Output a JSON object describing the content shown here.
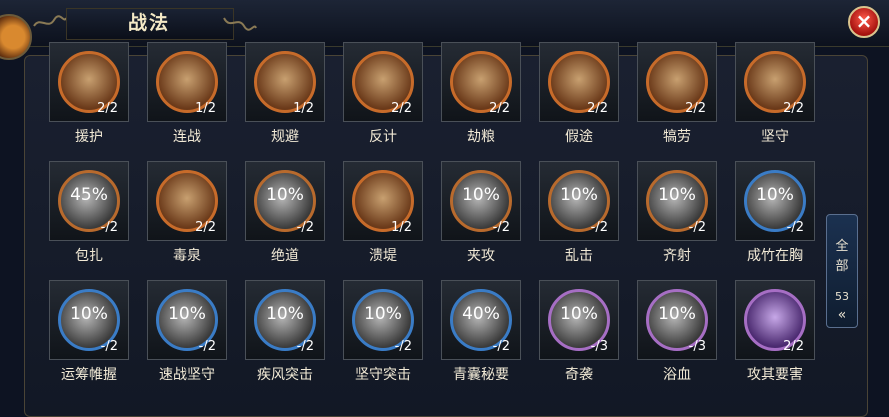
{
  "window": {
    "title": "战法",
    "close_label": "×"
  },
  "side_tab": {
    "line1": "全",
    "line2": "部",
    "count": "53",
    "arrow": "«"
  },
  "rows": [
    [
      {
        "name": "援护",
        "count": "2/2",
        "style": "orange"
      },
      {
        "name": "连战",
        "count": "1/2",
        "style": "orange"
      },
      {
        "name": "规避",
        "count": "1/2",
        "style": "orange"
      },
      {
        "name": "反计",
        "count": "2/2",
        "style": "orange"
      },
      {
        "name": "劫粮",
        "count": "2/2",
        "style": "orange"
      },
      {
        "name": "假途",
        "count": "2/2",
        "style": "orange"
      },
      {
        "name": "犒劳",
        "count": "2/2",
        "style": "orange"
      },
      {
        "name": "坚守",
        "count": "2/2",
        "style": "orange"
      }
    ],
    [
      {
        "name": "包扎",
        "pct": "45%",
        "count": "-/2",
        "style": "grey-o"
      },
      {
        "name": "毒泉",
        "count": "2/2",
        "style": "orange"
      },
      {
        "name": "绝道",
        "pct": "10%",
        "count": "-/2",
        "style": "grey-o"
      },
      {
        "name": "溃堤",
        "count": "1/2",
        "style": "orange"
      },
      {
        "name": "夹攻",
        "pct": "10%",
        "count": "-/2",
        "style": "grey-o"
      },
      {
        "name": "乱击",
        "pct": "10%",
        "count": "-/2",
        "style": "grey-o"
      },
      {
        "name": "齐射",
        "pct": "10%",
        "count": "-/2",
        "style": "grey-o"
      },
      {
        "name": "成竹在胸",
        "pct": "10%",
        "count": "-/2",
        "style": "grey-b"
      }
    ],
    [
      {
        "name": "运筹帷握",
        "pct": "10%",
        "count": "-/2",
        "style": "grey-b"
      },
      {
        "name": "速战坚守",
        "pct": "10%",
        "count": "-/2",
        "style": "grey-b"
      },
      {
        "name": "疾风突击",
        "pct": "10%",
        "count": "-/2",
        "style": "grey-b"
      },
      {
        "name": "坚守突击",
        "pct": "10%",
        "count": "-/2",
        "style": "grey-b"
      },
      {
        "name": "青囊秘要",
        "pct": "40%",
        "count": "-/2",
        "style": "grey-b"
      },
      {
        "name": "奇袭",
        "pct": "10%",
        "count": "-/3",
        "style": "grey-p"
      },
      {
        "name": "浴血",
        "pct": "10%",
        "count": "-/3",
        "style": "grey-p"
      },
      {
        "name": "攻其要害",
        "count": "2/2",
        "style": "purple"
      }
    ]
  ]
}
